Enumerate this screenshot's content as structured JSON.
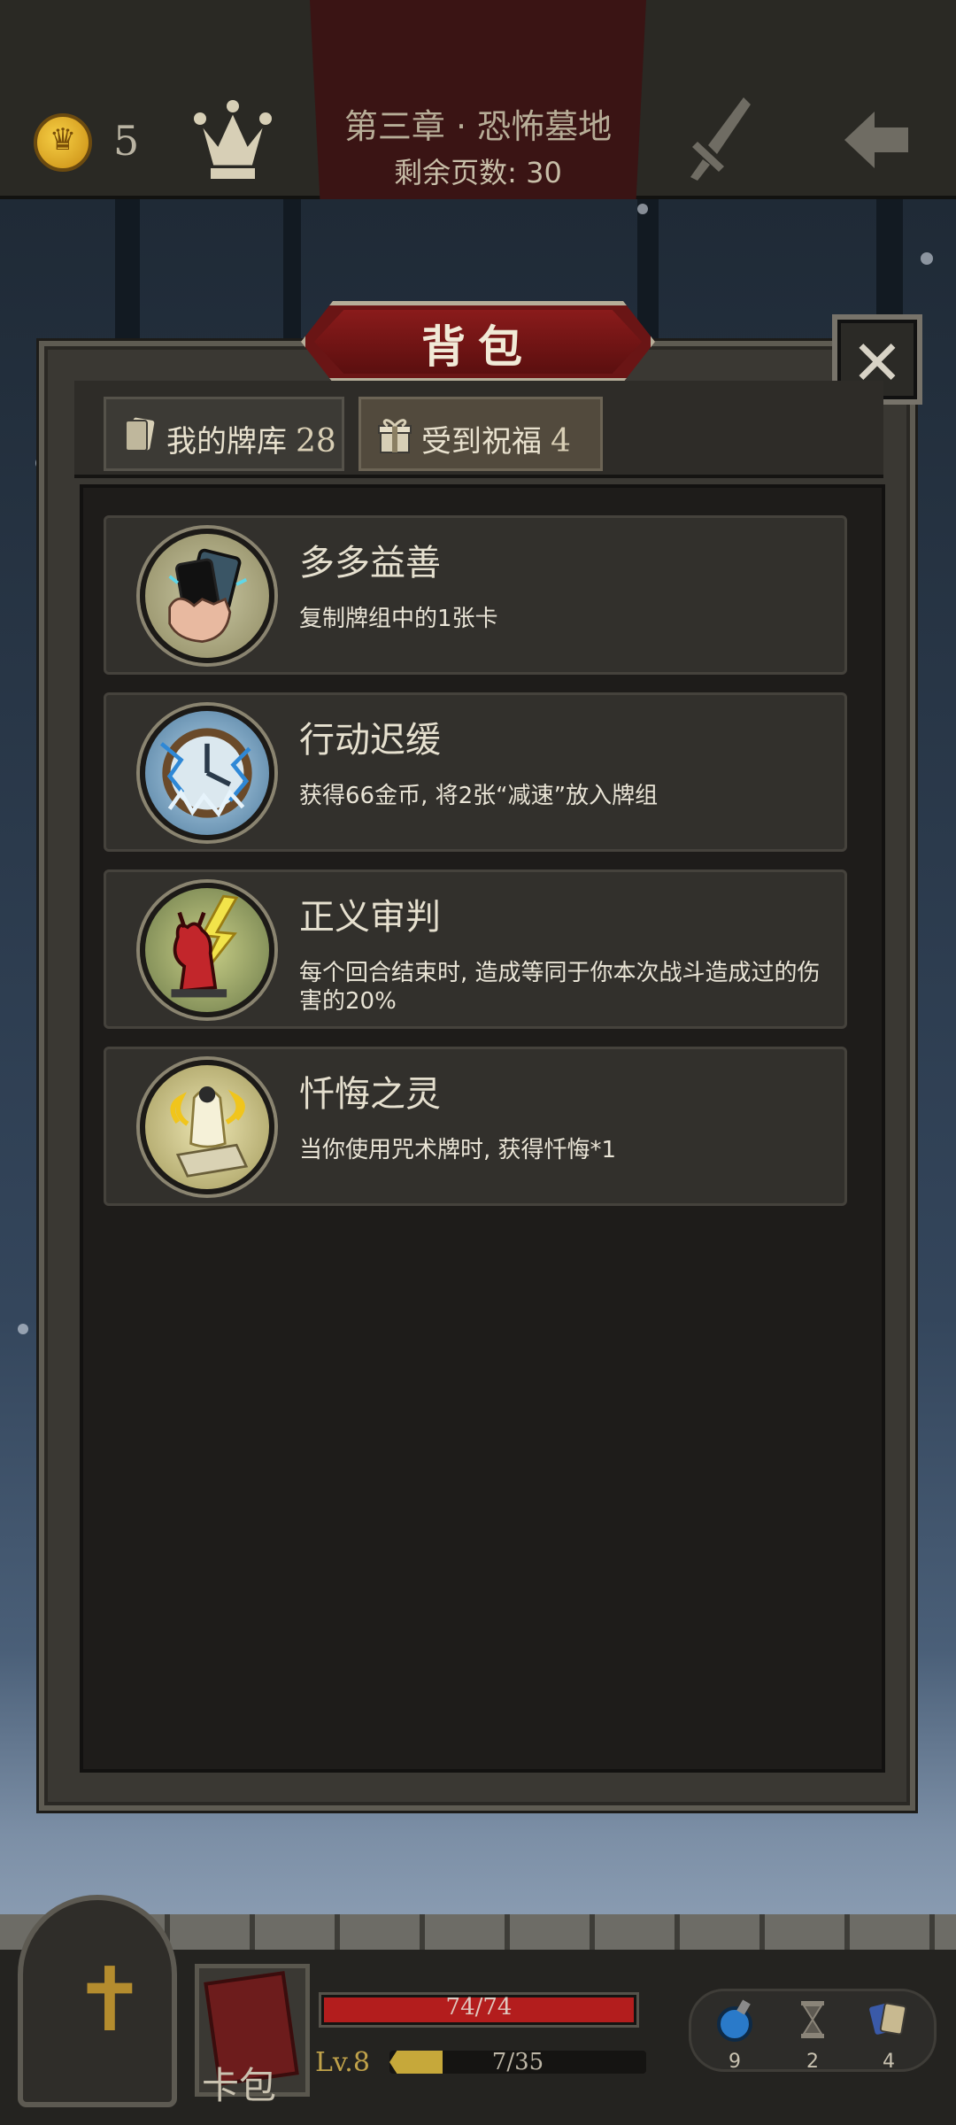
{
  "header": {
    "gold_count": "5",
    "chapter_title": "第三章 · 恐怖墓地",
    "pages_remaining": "剩余页数: 30"
  },
  "modal": {
    "title": "背包",
    "close_label": "✕",
    "tabs": [
      {
        "label": "我的牌库",
        "count": "28",
        "active": false
      },
      {
        "label": "受到祝福",
        "count": "4",
        "active": true
      }
    ],
    "blessings": [
      {
        "name": "多多益善",
        "description": "复制牌组中的1张卡",
        "icon": "hand-with-cards-icon"
      },
      {
        "name": "行动迟缓",
        "description": "获得66金币, 将2张“减速”放入牌组",
        "icon": "frozen-clock-icon"
      },
      {
        "name": "正义审判",
        "description": "每个回合结束时, 造成等同于你本次战斗造成过的伤害的20%",
        "icon": "lightning-demon-icon"
      },
      {
        "name": "忏悔之灵",
        "description": "当你使用咒术牌时, 获得忏悔*1",
        "icon": "repentant-spirit-icon"
      }
    ]
  },
  "footer": {
    "card_pack_label": "卡包",
    "hp_text": "74/74",
    "hp_fraction": 1.0,
    "level_text": "Lv.8",
    "xp_text": "7/35",
    "xp_fraction": 0.2,
    "resources": [
      {
        "icon": "potion-icon",
        "count": "9"
      },
      {
        "icon": "hourglass-icon",
        "count": "2"
      },
      {
        "icon": "cards-icon",
        "count": "4"
      }
    ]
  }
}
